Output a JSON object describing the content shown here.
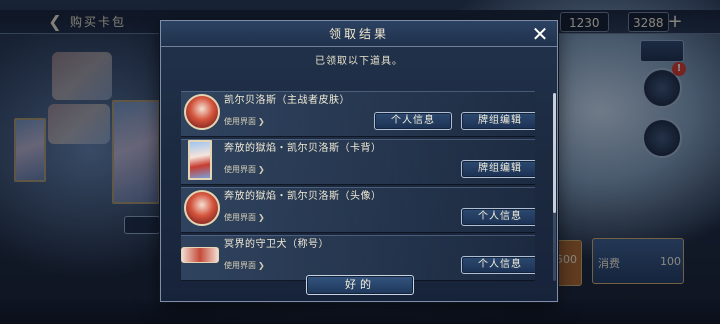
{
  "background": {
    "topbar": {
      "back_icon": "back-arrow-icon",
      "title": "购买卡包"
    },
    "currency": {
      "balance_a": "1230",
      "balance_b": "3288",
      "add_icon": "plus-icon"
    },
    "price": {
      "left": "500",
      "right_label": "消费",
      "right_value": "100"
    }
  },
  "modal": {
    "title": "领取结果",
    "close_icon": "close-icon",
    "subtitle": "已领取以下道具。",
    "items": [
      {
        "name": "凯尔贝洛斯（主战者皮肤）",
        "use": "使用界面",
        "thumb": "avatar-portrait",
        "buttons": [
          "个人信息",
          "牌组编辑"
        ]
      },
      {
        "name": "奔放的獄焰・凯尔贝洛斯（卡背）",
        "use": "使用界面",
        "thumb": "card-back",
        "buttons": [
          "牌组编辑"
        ]
      },
      {
        "name": "奔放的獄焰・凯尔贝洛斯（头像）",
        "use": "使用界面",
        "thumb": "avatar-portrait",
        "buttons": [
          "个人信息"
        ]
      },
      {
        "name": "冥界的守卫犬（称号）",
        "use": "使用界面",
        "thumb": "title-badge",
        "buttons": [
          "个人信息"
        ]
      }
    ],
    "ok_label": "好的"
  },
  "colors": {
    "panel": "#1c2a40",
    "header": "#2c4262",
    "button": "#2d4a72",
    "button_border": "#aebfd6",
    "text": "#f1ebd6"
  }
}
